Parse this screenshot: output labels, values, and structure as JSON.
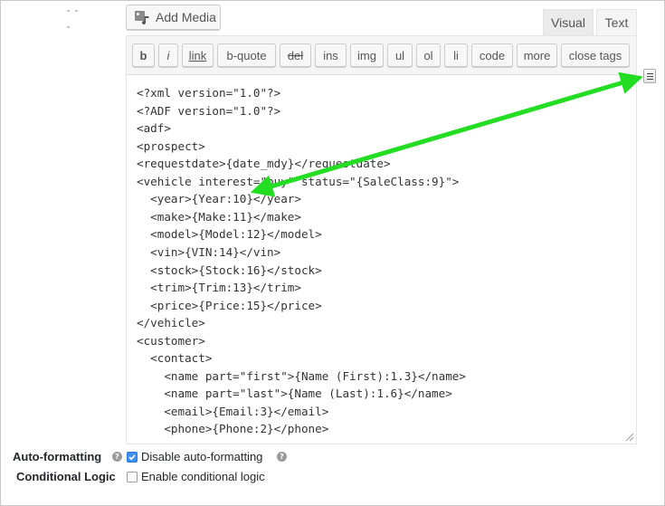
{
  "media_button": {
    "label": "Add Media",
    "icon": "media-icon"
  },
  "editor_tabs": [
    {
      "label": "Visual",
      "active": false
    },
    {
      "label": "Text",
      "active": true
    }
  ],
  "quicktags": [
    "b",
    "i",
    "link",
    "b-quote",
    "del",
    "ins",
    "img",
    "ul",
    "ol",
    "li",
    "code",
    "more",
    "close tags"
  ],
  "code_lines": [
    "<?xml version=\"1.0\"?>",
    "<?ADF version=\"1.0\"?>",
    "<adf>",
    "<prospect>",
    "<requestdate>{date_mdy}</requestdate>",
    "<vehicle interest=\"buy\" status=\"{SaleClass:9}\">",
    "  <year>{Year:10}</year>",
    "  <make>{Make:11}</make>",
    "  <model>{Model:12}</model>",
    "  <vin>{VIN:14}</vin>",
    "  <stock>{Stock:16}</stock>",
    "  <trim>{Trim:13}</trim>",
    "  <price>{Price:15}</price>",
    "</vehicle>",
    "<customer>",
    "  <contact>",
    "    <name part=\"first\">{Name (First):1.3}</name>",
    "    <name part=\"last\">{Name (Last):1.6}</name>",
    "    <email>{Email:3}</email>",
    "    <phone>{Phone:2}</phone>"
  ],
  "settings": {
    "auto_formatting": {
      "label": "Auto-formatting",
      "checkbox_label": "Disable auto-formatting",
      "checked": true
    },
    "conditional_logic": {
      "label": "Conditional Logic",
      "checkbox_label": "Enable conditional logic",
      "checked": false
    }
  },
  "colors": {
    "annotation_arrow": "#22dd22",
    "checkbox_checked": "#3b8ff5"
  }
}
